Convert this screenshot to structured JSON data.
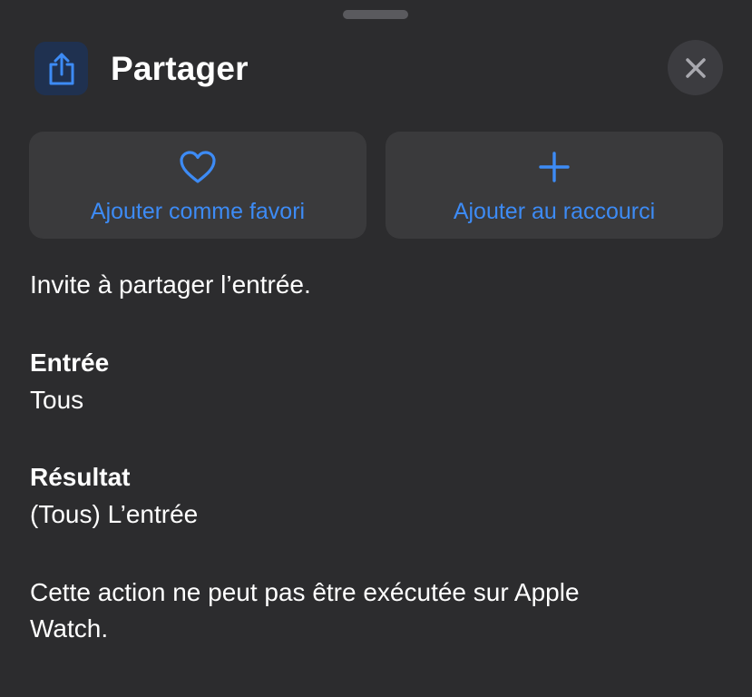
{
  "header": {
    "icon": "share-icon",
    "title": "Partager",
    "close_icon": "close-icon"
  },
  "actions": {
    "favorite": {
      "icon": "heart-icon",
      "label": "Ajouter comme favori"
    },
    "shortcut": {
      "icon": "plus-icon",
      "label": "Ajouter au raccourci"
    }
  },
  "content": {
    "description": "Invite à partager l’entrée.",
    "input_title": "Entrée",
    "input_value": "Tous",
    "result_title": "Résultat",
    "result_value": "(Tous) L’entrée",
    "note": "Cette action ne peut pas être exécutée sur Apple Watch."
  },
  "colors": {
    "background": "#2c2c2e",
    "button_background": "#3a3a3c",
    "accent": "#3d8bf5",
    "text": "#ffffff"
  }
}
